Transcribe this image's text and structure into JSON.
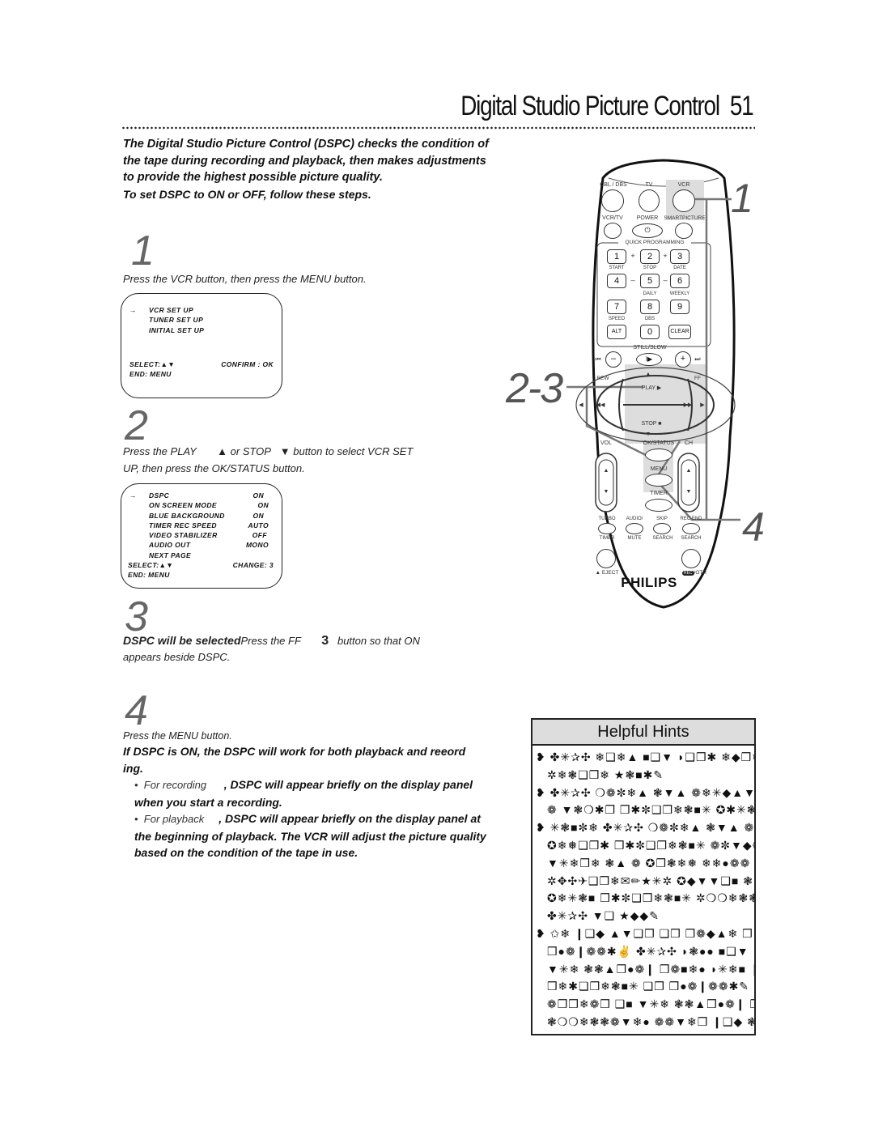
{
  "page": {
    "title": "Digital Studio Picture Control",
    "page_number": "51"
  },
  "intro": {
    "lines": [
      "The Digital Studio Picture Control (DSPC) checks the condition of",
      "the tape during recording and playback, then makes adjustments",
      "to provide the highest possible picture quality.",
      "To set DSPC to ON or OFF, follow these steps."
    ]
  },
  "steps": [
    {
      "number": "1",
      "text": "Press the VCR button, then press the MENU button.",
      "screen": {
        "cursor": "→",
        "items": [
          "VCR SET UP",
          "TUNER SET UP",
          "INITIAL SET UP"
        ],
        "select_label": "SELECT:▲▼",
        "confirm_label": "CONFIRM : OK",
        "end_label": "END: MENU"
      }
    },
    {
      "number": "2",
      "text_line1_a": "Press the PLAY",
      "text_line1_b": "▲ or STOP",
      "text_line1_c": "▼ button to select VCR SET",
      "text_line2": "UP, then press the OK/STATUS button.",
      "screen": {
        "cursor": "→",
        "items": [
          {
            "label": "DSPC",
            "value": "ON"
          },
          {
            "label": "ON SCREEN MODE",
            "value": "ON"
          },
          {
            "label": "BLUE BACKGROUND",
            "value": "ON"
          },
          {
            "label": "TIMER REC SPEED",
            "value": "AUTO"
          },
          {
            "label": "VIDEO STABILIZER",
            "value": "OFF"
          },
          {
            "label": "AUDIO OUT",
            "value": "MONO"
          },
          {
            "label": "NEXT PAGE",
            "value": ""
          }
        ],
        "select_label": "SELECT:▲▼",
        "change_label": "CHANGE: 3",
        "end_label": "END: MENU"
      }
    },
    {
      "number": "3",
      "text_bold": "DSPC will be selected",
      "text_a": "Press the FF",
      "text_symbol": "3",
      "text_b": "button so that ON",
      "text_line2": "appears beside DSPC."
    },
    {
      "number": "4",
      "text": "Press the MENU button.",
      "note_line1": "If DSPC is ON, the DSPC will work for both playback and reeord",
      "note_line2": "ing.",
      "bullets": [
        {
          "lead": "For recording",
          "line1": ", DSPC will appear briefly on the display panel",
          "line2": "when you start a recording."
        },
        {
          "lead": "For playback",
          "line1": ", DSPC will appear briefly on the display panel at",
          "line2": "the beginning of playback. The VCR will adjust the picture quality",
          "line3": "based on the condition of the tape in use."
        }
      ]
    }
  ],
  "callouts": {
    "one": "1",
    "two_three": "2-3",
    "four": "4"
  },
  "hints": {
    "title": "Helpful Hints",
    "lines": [
      {
        "bullet": true,
        "text": "✤✳✰✣ ❄❑❄▲ ■❑▼ ◗❑❒✱ ❄◆❒❄"
      },
      {
        "bullet": false,
        "text": "✲❄❃❑❒❄ ★❃■✱✎"
      },
      {
        "bullet": true,
        "text": "✤✳✰✣ ❍❁✼❄▲ ❃▼▲ ❁❄✳◆▲▼❍"
      },
      {
        "bullet": false,
        "text": "❁ ▼❃❍✱❒ ❒✱✼❑❒❄❃■✳ ✪✱✳❃"
      },
      {
        "bullet": true,
        "text": "✳❃■✼❄ ✤✳✰✣ ❍❁✼❄▲ ❃▼▲ ❁❄✳"
      },
      {
        "bullet": false,
        "text": "✪❄❅❑❒✱ ❒✱✼❑❒❄❃■✳ ❁✼▼◆❁❁"
      },
      {
        "bullet": false,
        "text": "▼✳❄❒❄ ❃▲ ❁ ✪❒❃❄❅ ❄❄●❁❁ ❁"
      },
      {
        "bullet": false,
        "text": "✲✥✣✈❑❒❄✉✏★✳✲ ✪◆▼▼❑■ ❃"
      },
      {
        "bullet": false,
        "text": "✪❄✳❃■ ❒✱✼❑❒❄❃■✳ ✲❍❍❄❃❃"
      },
      {
        "bullet": false,
        "text": "✤✳✰✣ ▼❑ ★◆◆✎"
      },
      {
        "bullet": true,
        "text": "✩❄ ❙❑◆ ▲▼❑❒ ❑❒ ❒❁◆▲❄ ❒❄❁"
      },
      {
        "bullet": false,
        "text": "❒●❁❙❁❁✱✌ ✤✳✰✣ ◗❃●● ■❑▼"
      },
      {
        "bullet": false,
        "text": "▼✳❄ ❃❃▲❒●❁❙ ❒❁■❄● ◗✳❄■ ❙"
      },
      {
        "bullet": false,
        "text": "❒❄✱❑❒❄❃■✳ ❑❒ ❒●❁❙❁❁✱✎"
      },
      {
        "bullet": false,
        "text": "❁❒❒❄❁❒ ❑■ ▼✳❄ ❃❃▲❒●❁❙ ❒"
      },
      {
        "bullet": false,
        "text": "❃❍❍❄❃❃❁▼❄● ❁❁▼❄❒ ❙❑◆ ❃"
      },
      {
        "bullet": false,
        "text": "❁■❄ ✪❄✳❃■ ❒✱✼❑❒❄❃■✳ ❑❒"
      }
    ]
  },
  "remote": {
    "brand": "PHILIPS",
    "labels": {
      "cbl_dbs": "CBL / DBS",
      "tv": "TV",
      "vcr": "VCR",
      "vcr_tv": "VCR/TV",
      "power": "POWER",
      "smartpicture": "SMARTPICTURE",
      "quick_programming": "QUICK PROGRAMMING",
      "start": "START",
      "stop": "STOP",
      "date": "DATE",
      "daily": "DAILY",
      "weekly": "WEEKLY",
      "speed": "SPEED",
      "dbs": "DBS",
      "alt": "ALT",
      "clear": "CLEAR",
      "still_slow": "STILL/SLOW",
      "rew": "REW",
      "ff": "FF",
      "play": "PLAY ▶",
      "stop_btn": "STOP ■",
      "vol": "VOL",
      "ok_status": "OK/STATUS",
      "ch": "CH",
      "menu": "MENU",
      "timer": "TIMER",
      "turbo": "TURBO",
      "turbo_sub": "TIMER",
      "audio": "AUDIO/",
      "audio_sub": "MUTE",
      "skip": "SKIP",
      "skip_sub": "SEARCH",
      "rec_end": "REC END",
      "rec_end_sub": "SEARCH",
      "eject": "▲ EJECT",
      "rec_otr": "/OTR",
      "rec_badge": "REC"
    },
    "keys": [
      "1",
      "2",
      "3",
      "4",
      "5",
      "6",
      "7",
      "8",
      "9",
      "0"
    ],
    "keypad_separators": [
      "+",
      "+",
      "–",
      "–"
    ],
    "transport": {
      "minus": "–",
      "plus": "+",
      "slow": "I▶",
      "skip_back": "⏮",
      "skip_fwd": "⏭",
      "rew_arrows": "◀◀",
      "ff_arrows": "▶▶",
      "up": "▲",
      "down": "▼",
      "left": "◀",
      "right": "▶"
    }
  }
}
